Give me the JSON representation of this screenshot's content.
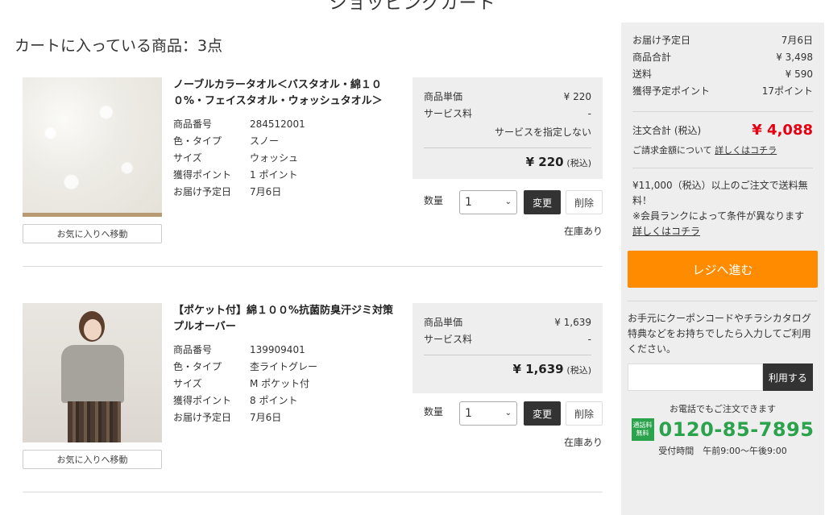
{
  "header": {
    "title": "ショッピングカート"
  },
  "cart": {
    "count_label": "カートに入っている商品：3点"
  },
  "labels": {
    "favorite": "お気に入りへ移動",
    "unit_price": "商品単価",
    "service_fee": "サービス料",
    "quantity": "数量",
    "change": "変更",
    "delete": "削除",
    "tax_included": "(税込)"
  },
  "items": [
    {
      "name": "ノーブルカラータオル＜バスタオル・綿１００%・フェイスタオル・ウォッシュタオル＞",
      "specs": [
        {
          "label": "商品番号",
          "value": "284512001"
        },
        {
          "label": "色・タイプ",
          "value": "スノー"
        },
        {
          "label": "サイズ",
          "value": "ウォッシュ"
        },
        {
          "label": "獲得ポイント",
          "value": "1 ポイント"
        },
        {
          "label": "お届け予定日",
          "value": "7月6日"
        }
      ],
      "unit_price": "¥ 220",
      "service_fee": "-",
      "service_note": "サービスを指定しない",
      "total": "¥ 220",
      "qty": "1",
      "stock": "在庫あり"
    },
    {
      "name": "【ポケット付】綿１００%抗菌防臭汗ジミ対策プルオーバー",
      "specs": [
        {
          "label": "商品番号",
          "value": "139909401"
        },
        {
          "label": "色・タイプ",
          "value": "杢ライトグレー"
        },
        {
          "label": "サイズ",
          "value": "M ポケット付"
        },
        {
          "label": "獲得ポイント",
          "value": "8 ポイント"
        },
        {
          "label": "お届け予定日",
          "value": "7月6日"
        }
      ],
      "unit_price": "¥ 1,639",
      "service_fee": "-",
      "total": "¥ 1,639",
      "qty": "1",
      "stock": "在庫あり"
    }
  ],
  "summary": {
    "delivery_label": "お届け予定日",
    "delivery_value": "7月6日",
    "subtotal_label": "商品合計",
    "subtotal_value": "¥ 3,498",
    "shipping_label": "送料",
    "shipping_value": "¥ 590",
    "points_label": "獲得予定ポイント",
    "points_value": "17ポイント",
    "total_label": "注文合計 (税込)",
    "total_value": "¥ 4,088",
    "billing_text": "ご請求金額について",
    "detail_link": "詳しくはコチラ",
    "ship_note_1": "¥11,000（税込）以上のご注文で送料無料！",
    "ship_note_2": "※会員ランクによって条件が異なります",
    "checkout": "レジへ進む",
    "coupon_text": "お手元にクーポンコードやチラシカタログ特典などをお持ちでしたら入力してご利用ください。",
    "coupon_button": "利用する",
    "phone_caption": "お電話でもご注文できます",
    "free_badge": "通話料無料",
    "phone_number": "0120-85-7895",
    "phone_hours": "受付時間　午前9:00〜午後9:00"
  },
  "colors": {
    "accent": "#ff8c00",
    "price_red": "#e60012",
    "phone_green": "#2ba24c"
  }
}
